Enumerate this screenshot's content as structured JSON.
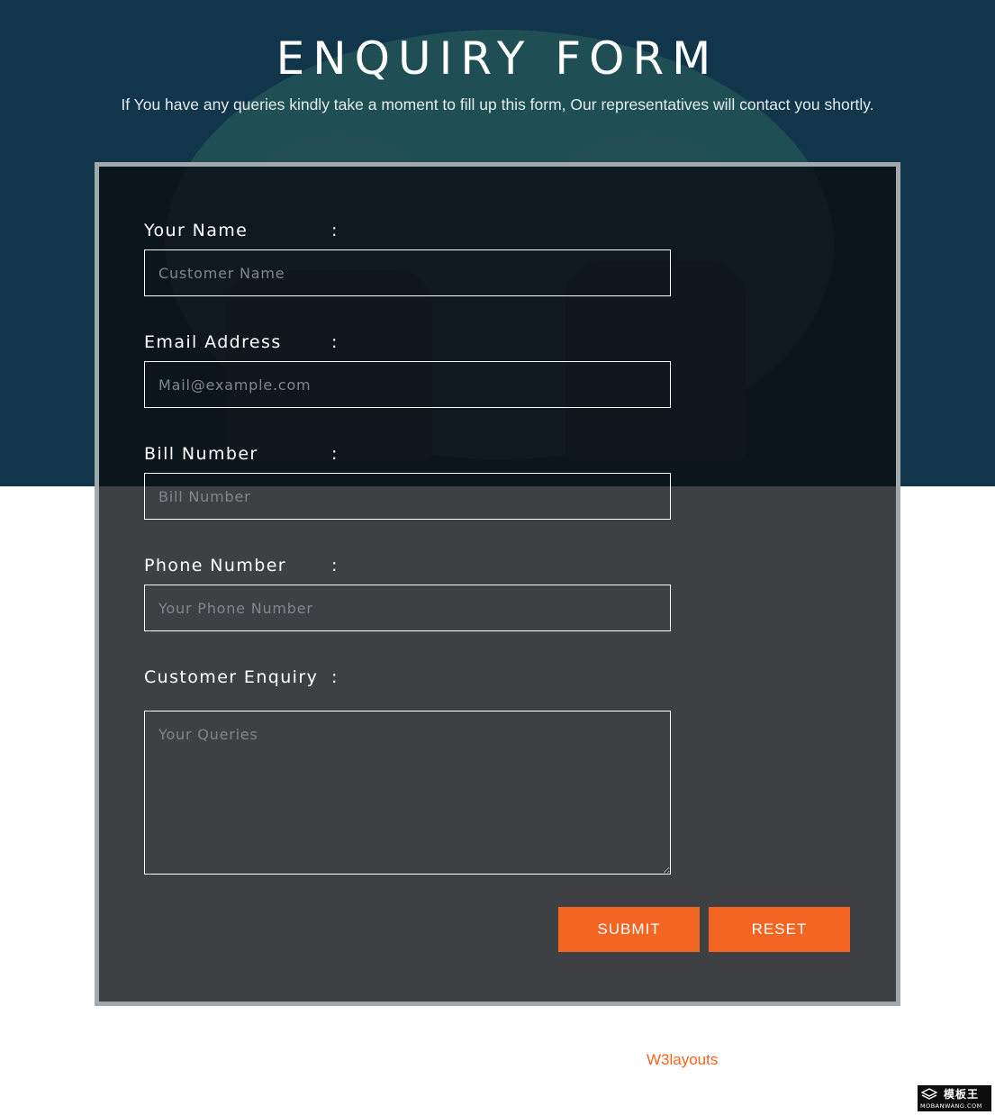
{
  "header": {
    "title": "ENQUIRY FORM",
    "subtitle": "If You have any queries kindly take a moment to fill up this form, Our representatives will contact you shortly."
  },
  "form": {
    "colon": ":",
    "fields": [
      {
        "label": "Your Name",
        "placeholder": "Customer Name",
        "value": ""
      },
      {
        "label": "Email Address",
        "placeholder": "Mail@example.com",
        "value": ""
      },
      {
        "label": "Bill Number",
        "placeholder": "Bill Number",
        "value": ""
      },
      {
        "label": "Phone Number",
        "placeholder": "Your Phone Number",
        "value": ""
      },
      {
        "label": "Customer Enquiry",
        "placeholder": "Your Queries",
        "value": ""
      }
    ],
    "submit_label": "SUBMIT",
    "reset_label": "RESET"
  },
  "footer": {
    "credit_link": "W3layouts"
  },
  "watermark": {
    "cn_text": "模板王",
    "en_text": "MOBANWANG.COM"
  },
  "colors": {
    "hero_background": "#11354a",
    "accent": "#f26522",
    "card_border": "#a2a9ad"
  }
}
